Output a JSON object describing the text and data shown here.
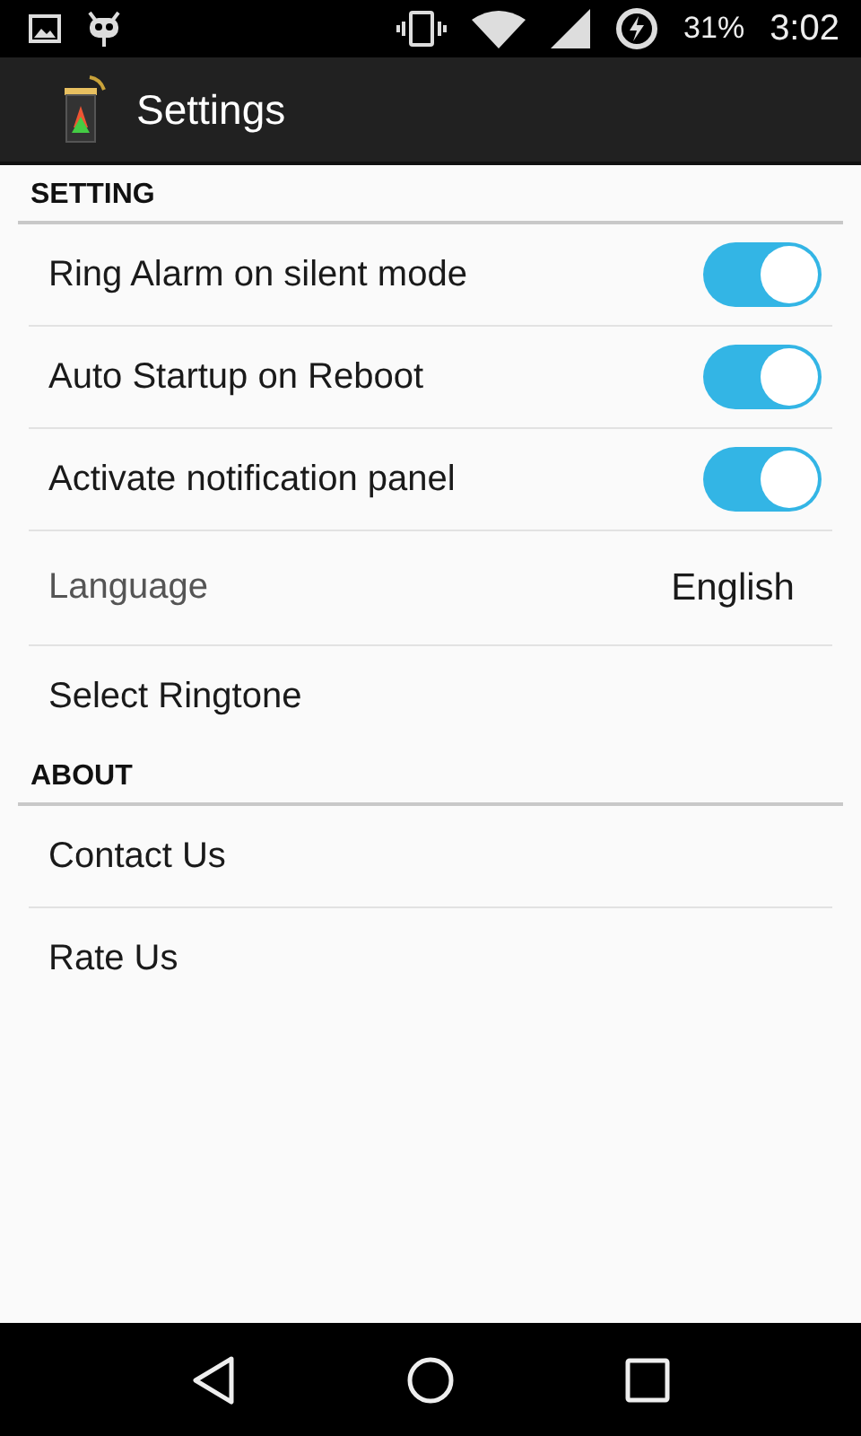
{
  "status_bar": {
    "battery": "31%",
    "time": "3:02"
  },
  "app_bar": {
    "title": "Settings"
  },
  "sections": [
    {
      "title": "SETTING",
      "items": [
        {
          "kind": "toggle",
          "label": "Ring Alarm on silent mode",
          "on": true
        },
        {
          "kind": "toggle",
          "label": "Auto Startup on Reboot",
          "on": true
        },
        {
          "kind": "toggle",
          "label": "Activate notification panel",
          "on": true
        },
        {
          "kind": "value",
          "label": "Language",
          "value": "English"
        },
        {
          "kind": "plain",
          "label": "Select Ringtone"
        }
      ]
    },
    {
      "title": "ABOUT",
      "items": [
        {
          "kind": "plain",
          "label": "Contact Us"
        },
        {
          "kind": "plain",
          "label": "Rate Us"
        }
      ]
    }
  ]
}
